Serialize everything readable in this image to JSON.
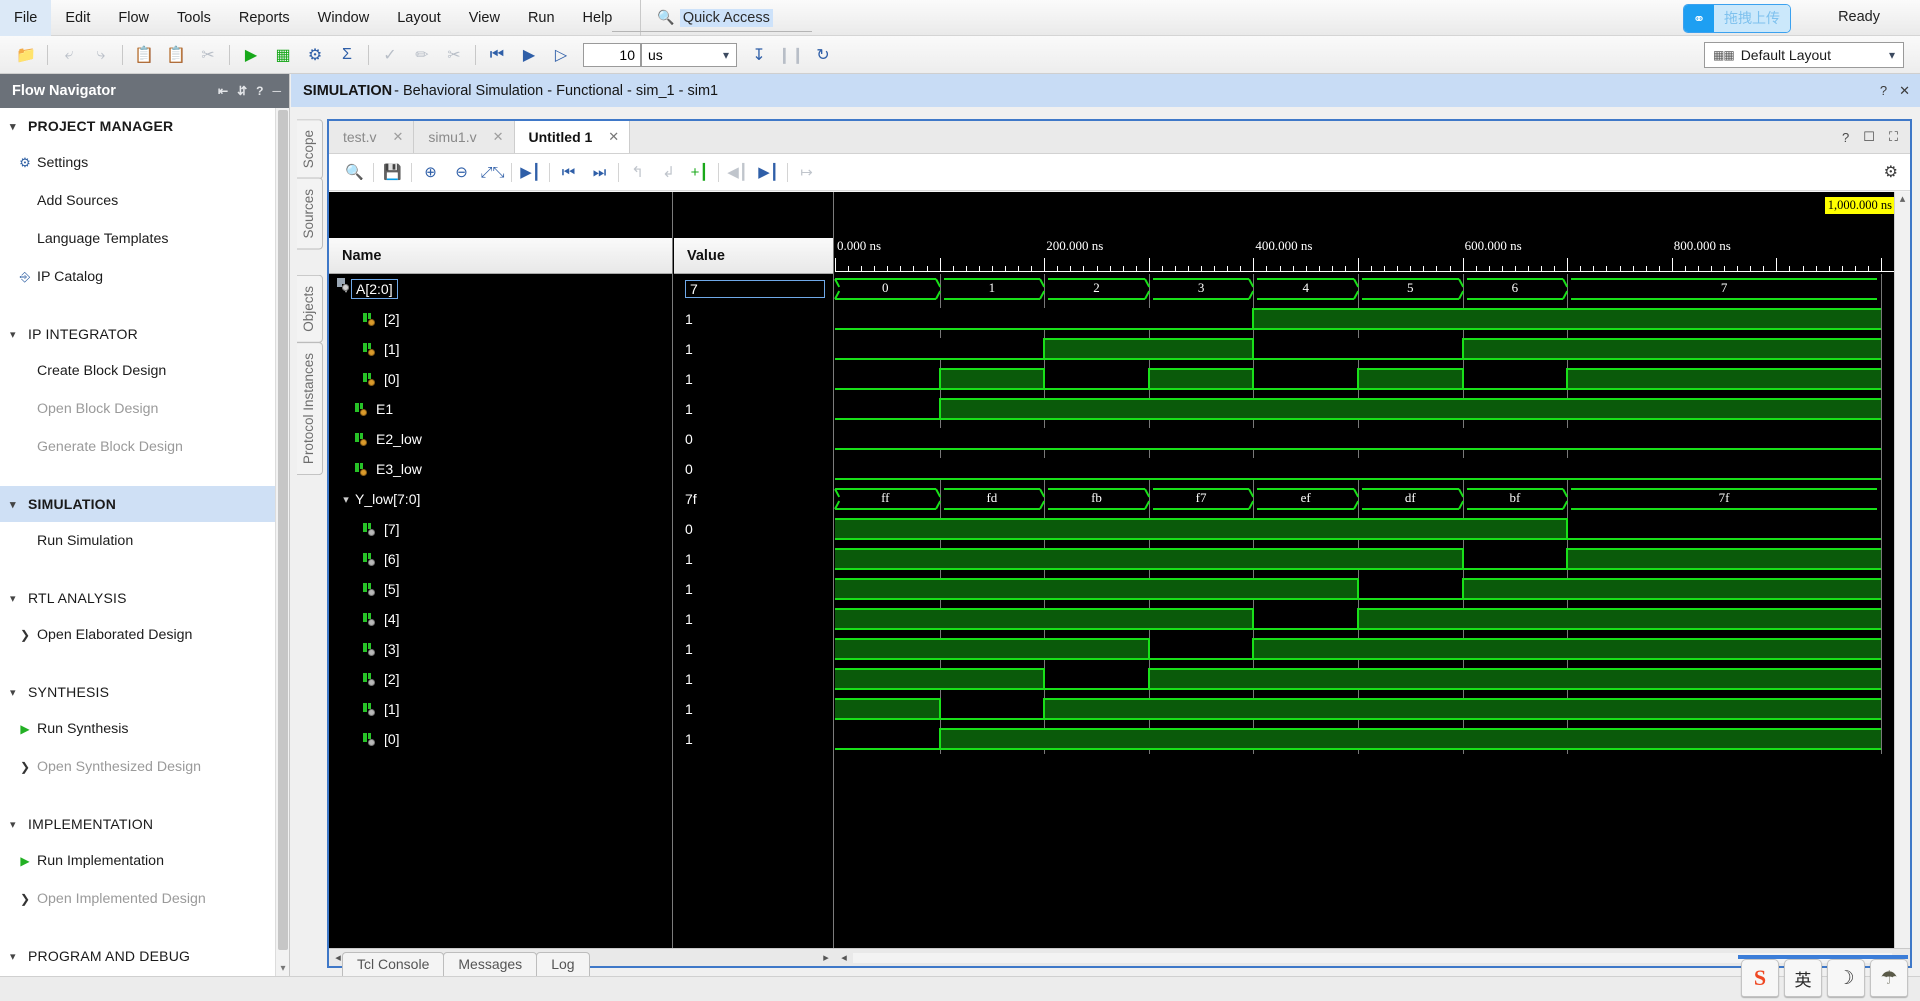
{
  "menubar": {
    "items": [
      "File",
      "Edit",
      "Flow",
      "Tools",
      "Reports",
      "Window",
      "Layout",
      "View",
      "Run",
      "Help"
    ],
    "quick_access": "Quick Access",
    "upload_label": "拖拽上传",
    "status": "Ready"
  },
  "toolbar": {
    "run_time_value": "10",
    "run_time_unit": "us",
    "layout_label": "Default Layout"
  },
  "sidebar": {
    "title": "Flow Navigator",
    "sections": [
      {
        "label": "PROJECT MANAGER",
        "bold": true,
        "selected": false,
        "items": [
          {
            "label": "Settings",
            "icon": "gear-icon",
            "disabled": false
          },
          {
            "label": "Add Sources",
            "icon": "none",
            "disabled": false
          },
          {
            "label": "Language Templates",
            "icon": "none",
            "disabled": false
          },
          {
            "label": "IP Catalog",
            "icon": "ip-icon",
            "disabled": false
          }
        ]
      },
      {
        "label": "IP INTEGRATOR",
        "bold": false,
        "selected": false,
        "items": [
          {
            "label": "Create Block Design",
            "icon": "none",
            "disabled": false
          },
          {
            "label": "Open Block Design",
            "icon": "none",
            "disabled": true
          },
          {
            "label": "Generate Block Design",
            "icon": "none",
            "disabled": true
          }
        ]
      },
      {
        "label": "SIMULATION",
        "bold": true,
        "selected": true,
        "items": [
          {
            "label": "Run Simulation",
            "icon": "none",
            "disabled": false
          }
        ]
      },
      {
        "label": "RTL ANALYSIS",
        "bold": false,
        "selected": false,
        "items": [
          {
            "label": "Open Elaborated Design",
            "icon": "arrow-icon",
            "disabled": false
          }
        ]
      },
      {
        "label": "SYNTHESIS",
        "bold": false,
        "selected": false,
        "items": [
          {
            "label": "Run Synthesis",
            "icon": "play-icon",
            "disabled": false
          },
          {
            "label": "Open Synthesized Design",
            "icon": "arrow-icon",
            "disabled": true
          }
        ]
      },
      {
        "label": "IMPLEMENTATION",
        "bold": false,
        "selected": false,
        "items": [
          {
            "label": "Run Implementation",
            "icon": "play-icon",
            "disabled": false
          },
          {
            "label": "Open Implemented Design",
            "icon": "arrow-icon",
            "disabled": true
          }
        ]
      },
      {
        "label": "PROGRAM AND DEBUG",
        "bold": false,
        "selected": false,
        "items": []
      }
    ]
  },
  "sim_panel": {
    "title_bold": "SIMULATION",
    "title_rest": " - Behavioral Simulation - Functional - sim_1 - sim1"
  },
  "side_tabs": [
    "Scope",
    "Sources",
    "Objects",
    "Protocol Instances"
  ],
  "wave_tabs": [
    {
      "label": "test.v",
      "active": false
    },
    {
      "label": "simu1.v",
      "active": false
    },
    {
      "label": "Untitled 1",
      "active": true
    }
  ],
  "wave_columns": {
    "name": "Name",
    "value": "Value"
  },
  "signals": [
    {
      "name": "A[2:0]",
      "value": "7",
      "indent": 0,
      "kind": "bus",
      "expanded": true,
      "selected": true
    },
    {
      "name": "[2]",
      "value": "1",
      "indent": 1,
      "kind": "bit",
      "expanded": false,
      "selected": false
    },
    {
      "name": "[1]",
      "value": "1",
      "indent": 1,
      "kind": "bit",
      "expanded": false,
      "selected": false
    },
    {
      "name": "[0]",
      "value": "1",
      "indent": 1,
      "kind": "bit",
      "expanded": false,
      "selected": false
    },
    {
      "name": "E1",
      "value": "1",
      "indent": 0,
      "kind": "bit",
      "expanded": false,
      "selected": false
    },
    {
      "name": "E2_low",
      "value": "0",
      "indent": 0,
      "kind": "bit",
      "expanded": false,
      "selected": false
    },
    {
      "name": "E3_low",
      "value": "0",
      "indent": 0,
      "kind": "bit",
      "expanded": false,
      "selected": false
    },
    {
      "name": "Y_low[7:0]",
      "value": "7f",
      "indent": 0,
      "kind": "bus",
      "expanded": true,
      "selected": false
    },
    {
      "name": "[7]",
      "value": "0",
      "indent": 1,
      "kind": "bitg",
      "expanded": false,
      "selected": false
    },
    {
      "name": "[6]",
      "value": "1",
      "indent": 1,
      "kind": "bitg",
      "expanded": false,
      "selected": false
    },
    {
      "name": "[5]",
      "value": "1",
      "indent": 1,
      "kind": "bitg",
      "expanded": false,
      "selected": false
    },
    {
      "name": "[4]",
      "value": "1",
      "indent": 1,
      "kind": "bitg",
      "expanded": false,
      "selected": false
    },
    {
      "name": "[3]",
      "value": "1",
      "indent": 1,
      "kind": "bitg",
      "expanded": false,
      "selected": false
    },
    {
      "name": "[2]",
      "value": "1",
      "indent": 1,
      "kind": "bitg",
      "expanded": false,
      "selected": false
    },
    {
      "name": "[1]",
      "value": "1",
      "indent": 1,
      "kind": "bitg",
      "expanded": false,
      "selected": false
    },
    {
      "name": "[0]",
      "value": "1",
      "indent": 1,
      "kind": "bitg",
      "expanded": false,
      "selected": false
    }
  ],
  "waveform": {
    "cursor_label": "1,000.000 ns",
    "time_axis": {
      "unit": "ns",
      "start": 0,
      "end": 1000,
      "labels": [
        "0.000 ns",
        "200.000 ns",
        "400.000 ns",
        "600.000 ns",
        "800.000 ns"
      ],
      "label_times": [
        0,
        200,
        400,
        600,
        800
      ],
      "major_step": 100,
      "minor_step": 12.5
    },
    "segment_times": [
      0,
      100,
      200,
      300,
      400,
      500,
      600,
      700,
      1000
    ],
    "bus_rows": {
      "A": [
        "0",
        "1",
        "2",
        "3",
        "4",
        "5",
        "6",
        "7"
      ],
      "Y_low": [
        "ff",
        "fd",
        "fb",
        "f7",
        "ef",
        "df",
        "bf",
        "7f"
      ]
    },
    "bit_rows": {
      "A2": [
        0,
        0,
        0,
        0,
        1,
        1,
        1,
        1
      ],
      "A1": [
        0,
        0,
        1,
        1,
        0,
        0,
        1,
        1
      ],
      "A0": [
        0,
        1,
        0,
        1,
        0,
        1,
        0,
        1
      ],
      "E1": [
        0,
        1,
        1,
        1,
        1,
        1,
        1,
        1
      ],
      "E2_low": [
        0,
        0,
        0,
        0,
        0,
        0,
        0,
        0
      ],
      "E3_low": [
        0,
        0,
        0,
        0,
        0,
        0,
        0,
        0
      ],
      "Y7": [
        1,
        1,
        1,
        1,
        1,
        1,
        1,
        0
      ],
      "Y6": [
        1,
        1,
        1,
        1,
        1,
        1,
        0,
        1
      ],
      "Y5": [
        1,
        1,
        1,
        1,
        1,
        0,
        1,
        1
      ],
      "Y4": [
        1,
        1,
        1,
        1,
        0,
        1,
        1,
        1
      ],
      "Y3": [
        1,
        1,
        1,
        0,
        1,
        1,
        1,
        1
      ],
      "Y2": [
        1,
        1,
        0,
        1,
        1,
        1,
        1,
        1
      ],
      "Y1": [
        1,
        0,
        1,
        1,
        1,
        1,
        1,
        1
      ],
      "Y0": [
        0,
        1,
        1,
        1,
        1,
        1,
        1,
        1
      ]
    }
  },
  "bottom_tabs": [
    "Tcl Console",
    "Messages",
    "Log"
  ],
  "tray": [
    {
      "name": "sogou-input-icon",
      "glyph": "S"
    },
    {
      "name": "chinese-english-toggle-icon",
      "glyph": "英"
    },
    {
      "name": "moon-icon",
      "glyph": "☽"
    },
    {
      "name": "skin-icon",
      "glyph": "☂"
    }
  ],
  "colors": {
    "accent": "#3f78c8",
    "wave_green": "#19e019",
    "wave_fill": "#0a5a0a",
    "sim_header": "#c8dcf5",
    "cursor_yellow": "#ffff00"
  }
}
